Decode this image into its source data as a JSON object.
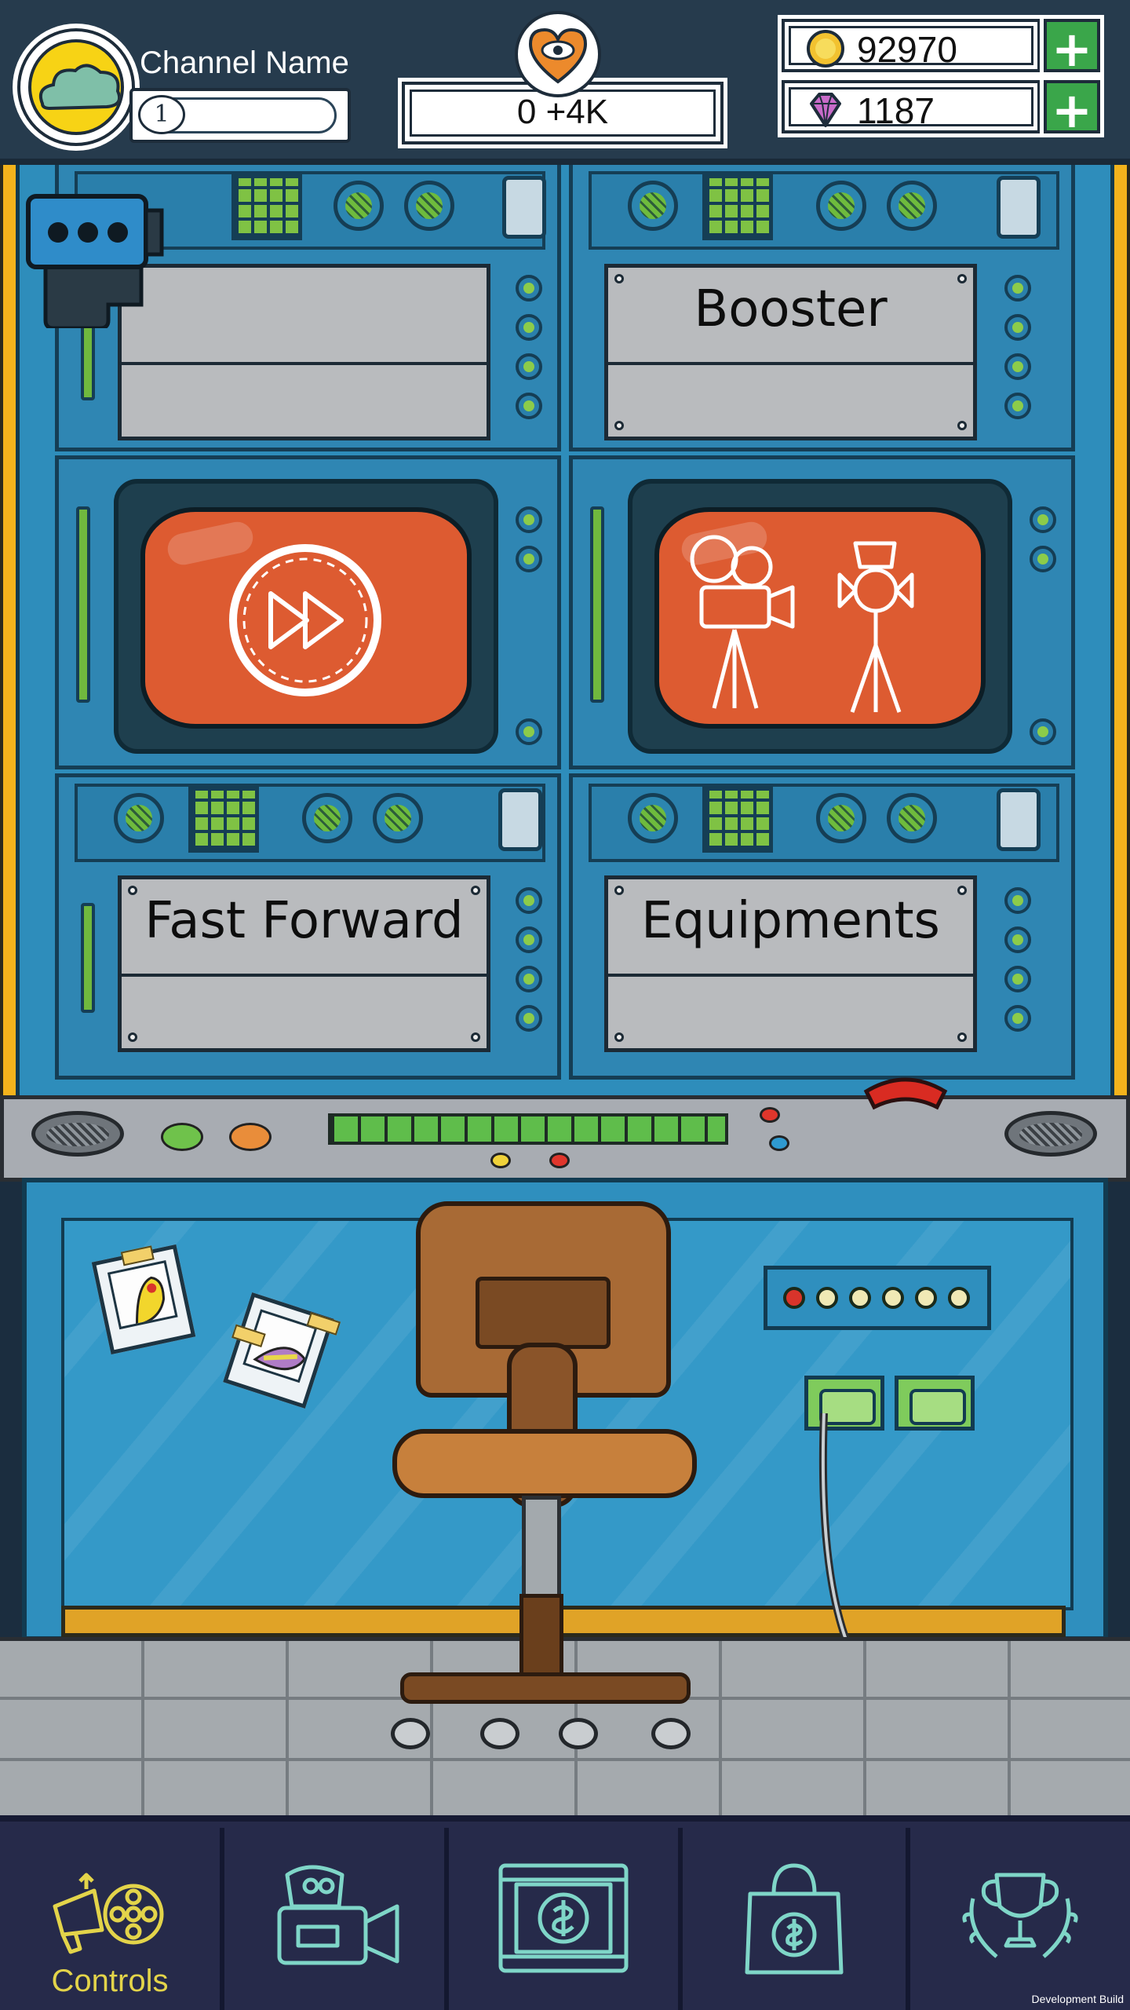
{
  "hud": {
    "channel_name": "Channel Name",
    "level": "1",
    "views": "0 +4K",
    "coins": "92970",
    "gems": "1187",
    "add_coins_label": "+",
    "add_gems_label": "+"
  },
  "panels": {
    "booster_label": "Booster",
    "fast_forward_label": "Fast Forward",
    "equipments_label": "Equipments"
  },
  "nav": {
    "tabs": [
      {
        "label": "Controls",
        "icon": "megaphone-film-reel-icon",
        "active": true
      },
      {
        "label": "",
        "icon": "movie-camera-icon",
        "active": false
      },
      {
        "label": "",
        "icon": "film-frame-dollar-icon",
        "active": false
      },
      {
        "label": "",
        "icon": "shopping-bag-dollar-icon",
        "active": false
      },
      {
        "label": "",
        "icon": "trophy-laurel-icon",
        "active": false
      }
    ]
  },
  "footer": {
    "build_label": "Development Build"
  },
  "colors": {
    "hud_bg": "#263b4d",
    "machine_blue": "#2e8dbb",
    "screen_orange": "#dd5b31",
    "plus_green": "#3aa64a",
    "nav_bg": "#262a4a",
    "nav_active": "#e3d44a",
    "nav_icon": "#7fd6c8"
  }
}
